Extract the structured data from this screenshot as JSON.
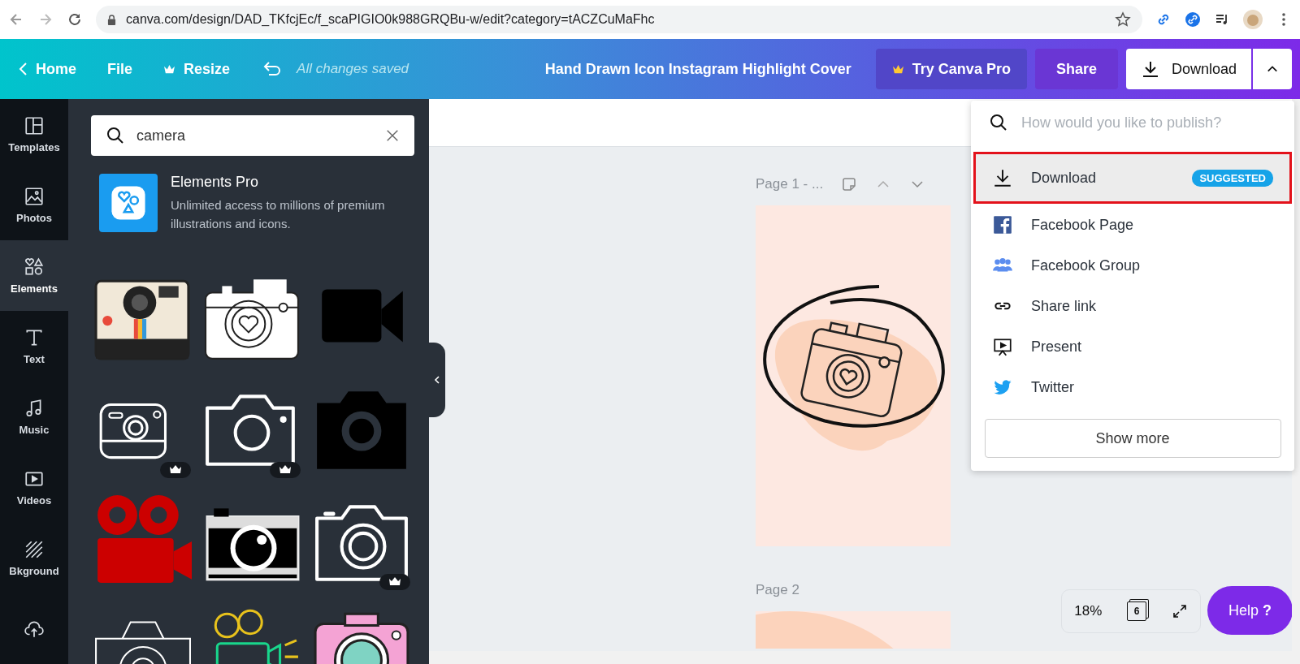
{
  "browser": {
    "url": "canva.com/design/DAD_TKfcjEc/f_scaPIGIO0k988GRQBu-w/edit?category=tACZCuMaFhc"
  },
  "toolbar": {
    "home": "Home",
    "file": "File",
    "resize": "Resize",
    "save_status": "All changes saved",
    "title": "Hand Drawn Icon Instagram Highlight Cover",
    "pro_button": "Try Canva Pro",
    "share_button": "Share",
    "download_button": "Download"
  },
  "rail": [
    {
      "label": "Templates",
      "selected": false
    },
    {
      "label": "Photos",
      "selected": false
    },
    {
      "label": "Elements",
      "selected": true
    },
    {
      "label": "Text",
      "selected": false
    },
    {
      "label": "Music",
      "selected": false
    },
    {
      "label": "Videos",
      "selected": false
    },
    {
      "label": "Bkground",
      "selected": false
    },
    {
      "selected": false
    }
  ],
  "search": {
    "value": "camera"
  },
  "promo": {
    "title": "Elements Pro",
    "text": "Unlimited access to millions of premium illustrations and icons."
  },
  "elements": [
    {
      "kind": "polaroid",
      "premium": false
    },
    {
      "kind": "heart",
      "premium": false
    },
    {
      "kind": "video",
      "premium": false
    },
    {
      "kind": "line-small",
      "premium": true
    },
    {
      "kind": "line",
      "premium": true
    },
    {
      "kind": "solid",
      "premium": false
    },
    {
      "kind": "film",
      "premium": false
    },
    {
      "kind": "retro",
      "premium": false
    },
    {
      "kind": "ring",
      "premium": true
    },
    {
      "kind": "sketch",
      "premium": false
    },
    {
      "kind": "neon",
      "premium": false
    },
    {
      "kind": "pink",
      "premium": false
    }
  ],
  "pages": [
    {
      "label": "Page 1 - ..."
    },
    {
      "label": "Page 2"
    }
  ],
  "publish_menu": {
    "placeholder": "How would you like to publish?",
    "items": [
      {
        "label": "Download",
        "badge": "SUGGESTED",
        "selected": true
      },
      {
        "label": "Facebook Page",
        "selected": false
      },
      {
        "label": "Facebook Group",
        "selected": false
      },
      {
        "label": "Share link",
        "selected": false
      },
      {
        "label": "Present",
        "selected": false
      },
      {
        "label": "Twitter",
        "selected": false
      }
    ],
    "more_button": "Show more"
  },
  "zoom": {
    "value": "18%",
    "page_count": "6"
  },
  "help_button": {
    "label": "Help",
    "icon": "?"
  }
}
